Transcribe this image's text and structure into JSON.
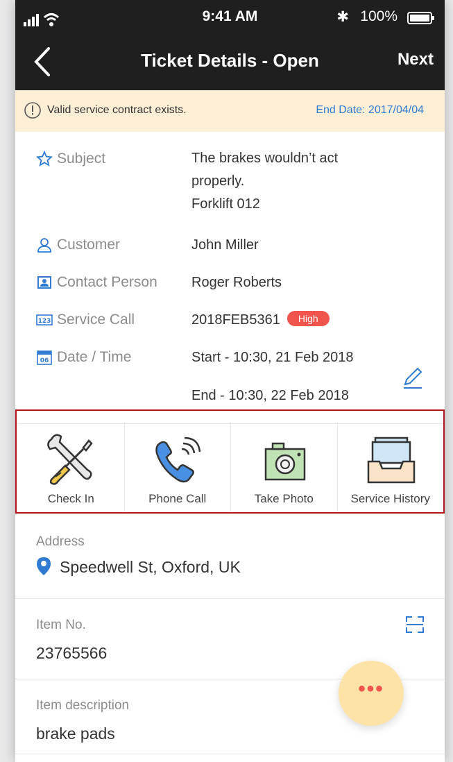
{
  "status": {
    "time": "9:41 AM",
    "battery": "100%"
  },
  "nav": {
    "title": "Ticket Details - Open",
    "next": "Next"
  },
  "banner": {
    "message": "Valid service contract exists.",
    "end_date": "End Date: 2017/04/04"
  },
  "details": {
    "subject_label": "Subject",
    "subject_line1": "The brakes wouldn’t act",
    "subject_line2": "properly.",
    "subject_line3": "Forklift 012",
    "customer_label": "Customer",
    "customer_value": "John Miller",
    "contact_label": "Contact Person",
    "contact_value": "Roger Roberts",
    "service_label": "Service Call",
    "service_value": "2018FEB5361",
    "priority": "High",
    "date_label": "Date / Time",
    "start": "Start - 10:30, 21 Feb 2018",
    "end": "End - 10:30, 22 Feb 2018"
  },
  "actions": [
    {
      "label": "Check In",
      "icon": "tools-icon"
    },
    {
      "label": "Phone Call",
      "icon": "phone-icon"
    },
    {
      "label": "Take Photo",
      "icon": "camera-icon"
    },
    {
      "label": "Service History",
      "icon": "inbox-icon"
    }
  ],
  "address": {
    "label": "Address",
    "value": "Speedwell St, Oxford, UK"
  },
  "item_no": {
    "label": "Item No.",
    "value": "23765566"
  },
  "item_desc": {
    "label": "Item description",
    "value": "brake pads"
  },
  "fab": {
    "label": "•••"
  },
  "colors": {
    "accent": "#2f7bd1",
    "badge": "#f0544c",
    "banner": "#fdefd5",
    "highlight": "#b3141c"
  }
}
